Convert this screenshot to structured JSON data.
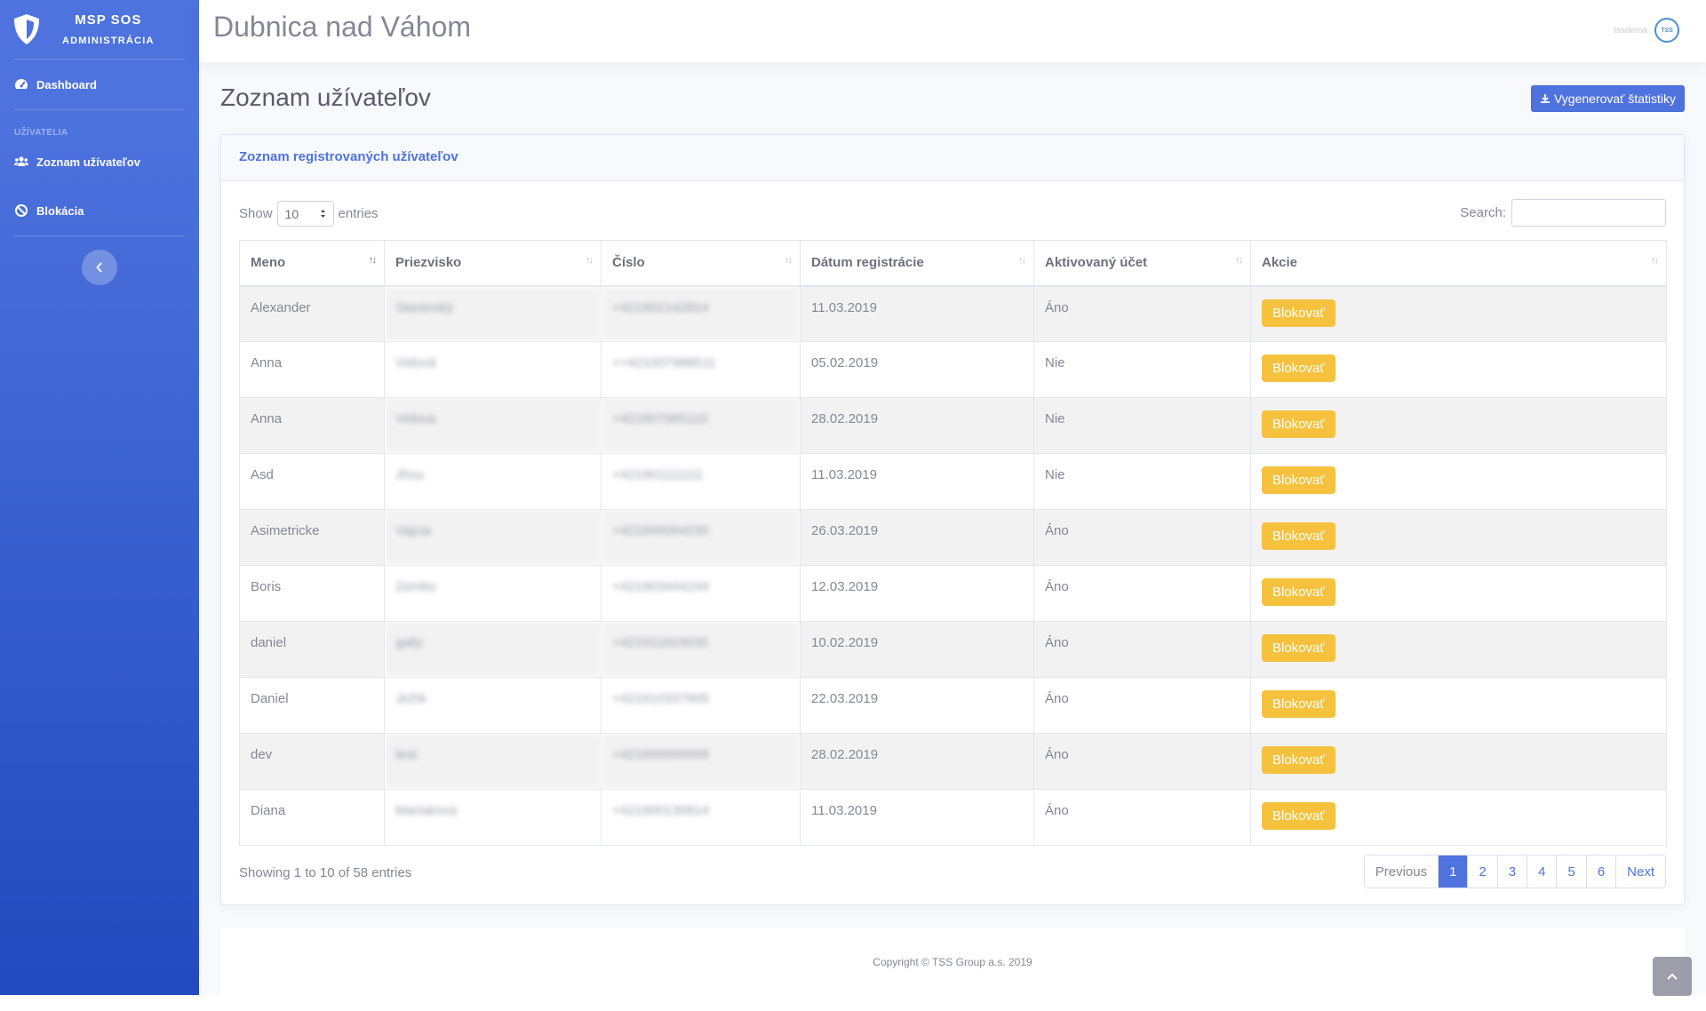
{
  "sidebar": {
    "brand_title": "MSP SOS",
    "brand_subtitle": "ADMINISTRÁCIA",
    "dashboard_label": "Dashboard",
    "section_heading": "UŽÍVATELIA",
    "users_label": "Zoznam užívateľov",
    "block_label": "Blokácia"
  },
  "topbar": {
    "title": "Dubnica nad Váhom",
    "user_name": "tssdema",
    "avatar_text": "TSS"
  },
  "page": {
    "header": "Zoznam užívateľov",
    "generate_button": "Vygenerovať štatistiky"
  },
  "card": {
    "title": "Zoznam registrovaných užívateľov"
  },
  "datatable": {
    "show_label": "Show",
    "entries_label": "entries",
    "length_value": "10",
    "search_label": "Search:",
    "search_value": "",
    "columns": [
      "Meno",
      "Priezvisko",
      "Číslo",
      "Dátum registrácie",
      "Aktivovaný účet",
      "Akcie"
    ],
    "rows": [
      {
        "meno": "Alexander",
        "priezvisko": "Staninský",
        "cislo": "+421902142814",
        "datum": "11.03.2019",
        "aktivny": "Áno",
        "akcia": "Blokovať"
      },
      {
        "meno": "Anna",
        "priezvisko": "Vidová",
        "cislo": "++421007988511",
        "datum": "05.02.2019",
        "aktivny": "Nie",
        "akcia": "Blokovať"
      },
      {
        "meno": "Anna",
        "priezvisko": "Vidova",
        "cislo": "+421907065110",
        "datum": "28.02.2019",
        "aktivny": "Nie",
        "akcia": "Blokovať"
      },
      {
        "meno": "Asd",
        "priezvisko": "Jhsu",
        "cislo": "+421901111111",
        "datum": "11.03.2019",
        "aktivny": "Nie",
        "akcia": "Blokovať"
      },
      {
        "meno": "Asimetricke",
        "priezvisko": "Vajcia",
        "cislo": "+421949064230",
        "datum": "26.03.2019",
        "aktivny": "Áno",
        "akcia": "Blokovať"
      },
      {
        "meno": "Boris",
        "priezvisko": "Zemko",
        "cislo": "+421903444244",
        "datum": "12.03.2019",
        "aktivny": "Áno",
        "akcia": "Blokovať"
      },
      {
        "meno": "daniel",
        "priezvisko": "gally",
        "cislo": "+421911619030",
        "datum": "10.02.2019",
        "aktivny": "Áno",
        "akcia": "Blokovať"
      },
      {
        "meno": "Daniel",
        "priezvisko": "Ježík",
        "cislo": "+421910337905",
        "datum": "22.03.2019",
        "aktivny": "Áno",
        "akcia": "Blokovať"
      },
      {
        "meno": "dev",
        "priezvisko": "test",
        "cislo": "+421999999999",
        "datum": "28.02.2019",
        "aktivny": "Áno",
        "akcia": "Blokovať"
      },
      {
        "meno": "Diana",
        "priezvisko": "Mariakova",
        "cislo": "+421900130814",
        "datum": "11.03.2019",
        "aktivny": "Áno",
        "akcia": "Blokovať"
      }
    ],
    "info": "Showing 1 to 10 of 58 entries",
    "pagination": {
      "previous": "Previous",
      "pages": [
        "1",
        "2",
        "3",
        "4",
        "5",
        "6"
      ],
      "active": "1",
      "next": "Next"
    }
  },
  "footer": {
    "copyright": "Copyright © TSS Group a.s. 2019"
  },
  "colors": {
    "primary": "#4e73df",
    "warning": "#f6c23e",
    "sidebar_gradient_start": "#4e73df",
    "sidebar_gradient_end": "#224abe"
  },
  "icons": {
    "brand": "shield-icon",
    "dashboard": "tachometer-icon",
    "users": "users-icon",
    "block": "ban-icon",
    "toggle": "chevron-left-icon",
    "generate": "download-icon",
    "scroll_top": "chevron-up-icon"
  }
}
